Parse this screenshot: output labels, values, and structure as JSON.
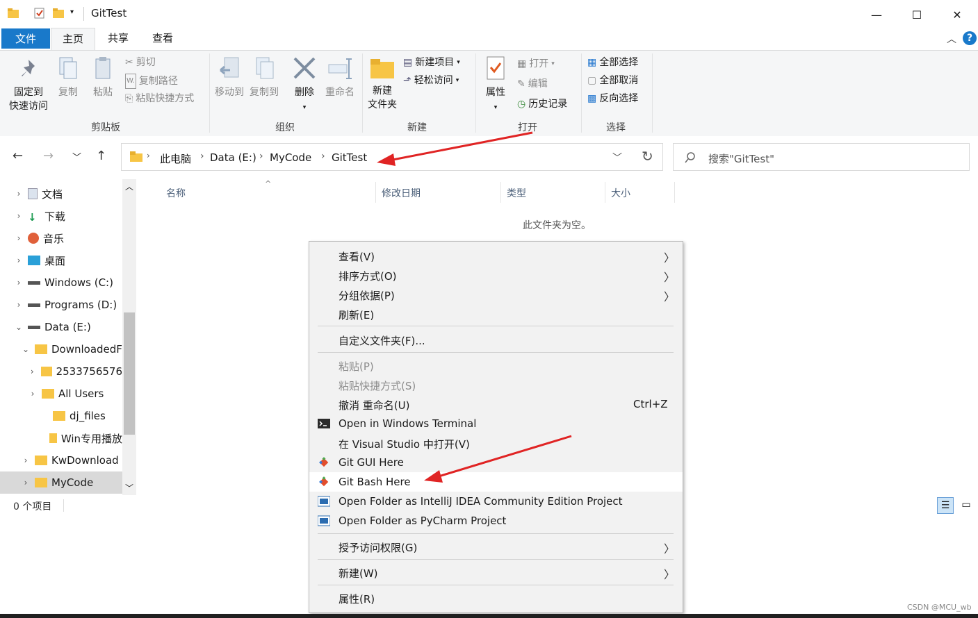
{
  "window": {
    "title": "GitTest",
    "minimize": "—",
    "maximize": "☐",
    "close": "✕"
  },
  "tabs": {
    "file": "文件",
    "home": "主页",
    "share": "共享",
    "view": "查看"
  },
  "ribbon": {
    "clipboard": {
      "label": "剪贴板",
      "pin_line1": "固定到",
      "pin_line2": "快速访问",
      "copy": "复制",
      "paste": "粘贴",
      "cut": "剪切",
      "copy_path": "复制路径",
      "paste_shortcut": "粘贴快捷方式"
    },
    "organize": {
      "label": "组织",
      "move_to": "移动到",
      "copy_to": "复制到",
      "delete": "删除",
      "rename": "重命名"
    },
    "new": {
      "label": "新建",
      "new_folder_line1": "新建",
      "new_folder_line2": "文件夹",
      "new_item": "新建项目",
      "easy_access": "轻松访问"
    },
    "open": {
      "label": "打开",
      "properties": "属性",
      "open": "打开",
      "edit": "编辑",
      "history": "历史记录"
    },
    "select": {
      "label": "选择",
      "select_all": "全部选择",
      "select_none": "全部取消",
      "invert": "反向选择"
    }
  },
  "address": {
    "crumbs": [
      "此电脑",
      "Data (E:)",
      "MyCode",
      "GitTest"
    ],
    "search_placeholder": "搜索\"GitTest\""
  },
  "nav_tree": [
    {
      "label": "文档",
      "icon": "documents-icon"
    },
    {
      "label": "下载",
      "icon": "download-icon"
    },
    {
      "label": "音乐",
      "icon": "music-icon"
    },
    {
      "label": "桌面",
      "icon": "desktop-icon"
    },
    {
      "label": "Windows (C:)",
      "icon": "drive-icon"
    },
    {
      "label": "Programs (D:)",
      "icon": "drive-icon"
    },
    {
      "label": "Data (E:)",
      "icon": "drive-icon"
    },
    {
      "label": "DownloadedF",
      "icon": "folder-icon"
    },
    {
      "label": "2533756576",
      "icon": "folder-icon"
    },
    {
      "label": "All Users",
      "icon": "folder-icon"
    },
    {
      "label": "dj_files",
      "icon": "folder-icon"
    },
    {
      "label": "Win专用播放",
      "icon": "folder-icon"
    },
    {
      "label": "KwDownload",
      "icon": "folder-icon"
    },
    {
      "label": "MyCode",
      "icon": "folder-icon"
    }
  ],
  "columns": {
    "name": "名称",
    "modified": "修改日期",
    "type": "类型",
    "size": "大小"
  },
  "empty_message": "此文件夹为空。",
  "status": {
    "count": "0 个项目"
  },
  "context_menu": {
    "view": "查看(V)",
    "sort": "排序方式(O)",
    "group": "分组依据(P)",
    "refresh": "刷新(E)",
    "customize": "自定义文件夹(F)...",
    "paste": "粘贴(P)",
    "paste_shortcut": "粘贴快捷方式(S)",
    "undo": "撤消 重命名(U)",
    "undo_shortcut": "Ctrl+Z",
    "terminal": "Open in Windows Terminal",
    "visual_studio": "在 Visual Studio 中打开(V)",
    "git_gui": "Git GUI Here",
    "git_bash": "Git Bash Here",
    "intellij": "Open Folder as IntelliJ IDEA Community Edition Project",
    "pycharm": "Open Folder as PyCharm Project",
    "grant_access": "授予访问权限(G)",
    "new": "新建(W)",
    "properties": "属性(R)"
  },
  "watermark": "CSDN @MCU_wb",
  "colors": {
    "accent": "#1979ca",
    "annotation_arrow": "#e02424",
    "folder": "#f7c545"
  }
}
